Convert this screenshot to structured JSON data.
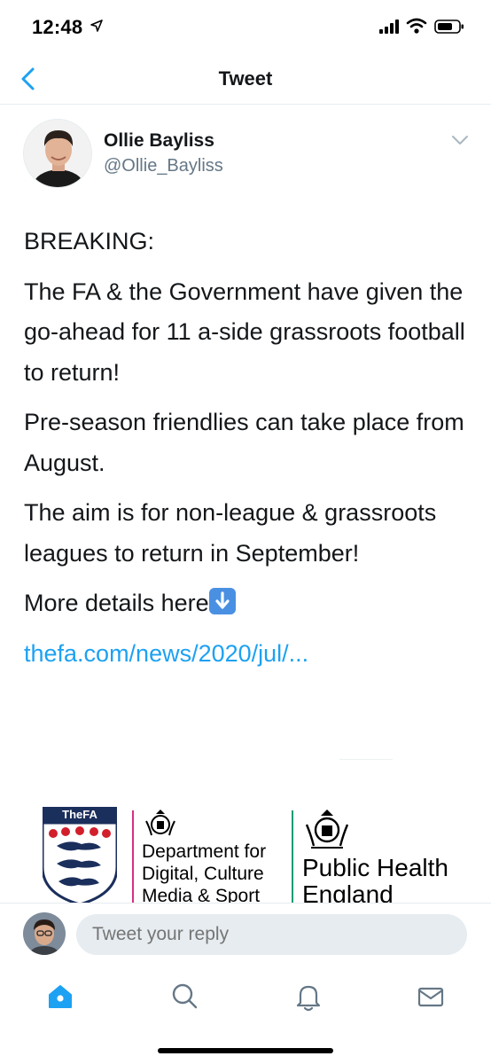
{
  "status_bar": {
    "time": "12:48"
  },
  "nav": {
    "title": "Tweet"
  },
  "author": {
    "name": "Ollie Bayliss",
    "handle": "@Ollie_Bayliss"
  },
  "tweet": {
    "paragraphs": [
      "BREAKING:",
      "The FA & the Government have given the go-ahead for 11 a-side grassroots football to return!",
      "Pre-season friendlies can take place from August.",
      "The aim is for non-league & grassroots leagues to return in September!"
    ],
    "more_details": "More details here",
    "link": "thefa.com/news/2020/jul/..."
  },
  "media": {
    "fa_label": "TheFA",
    "dcms_line1": "Department for",
    "dcms_line2": "Digital, Culture",
    "dcms_line3": "Media & Sport",
    "phe_line1": "Public Health",
    "phe_line2": "England"
  },
  "reply": {
    "placeholder": "Tweet your reply"
  },
  "tabs": {
    "home": "home-icon",
    "search": "search-icon",
    "notifications": "bell-icon",
    "messages": "mail-icon"
  },
  "colors": {
    "accent": "#1da1f2",
    "text": "#14171a",
    "secondary": "#657786",
    "divider": "#e6ecf0"
  }
}
